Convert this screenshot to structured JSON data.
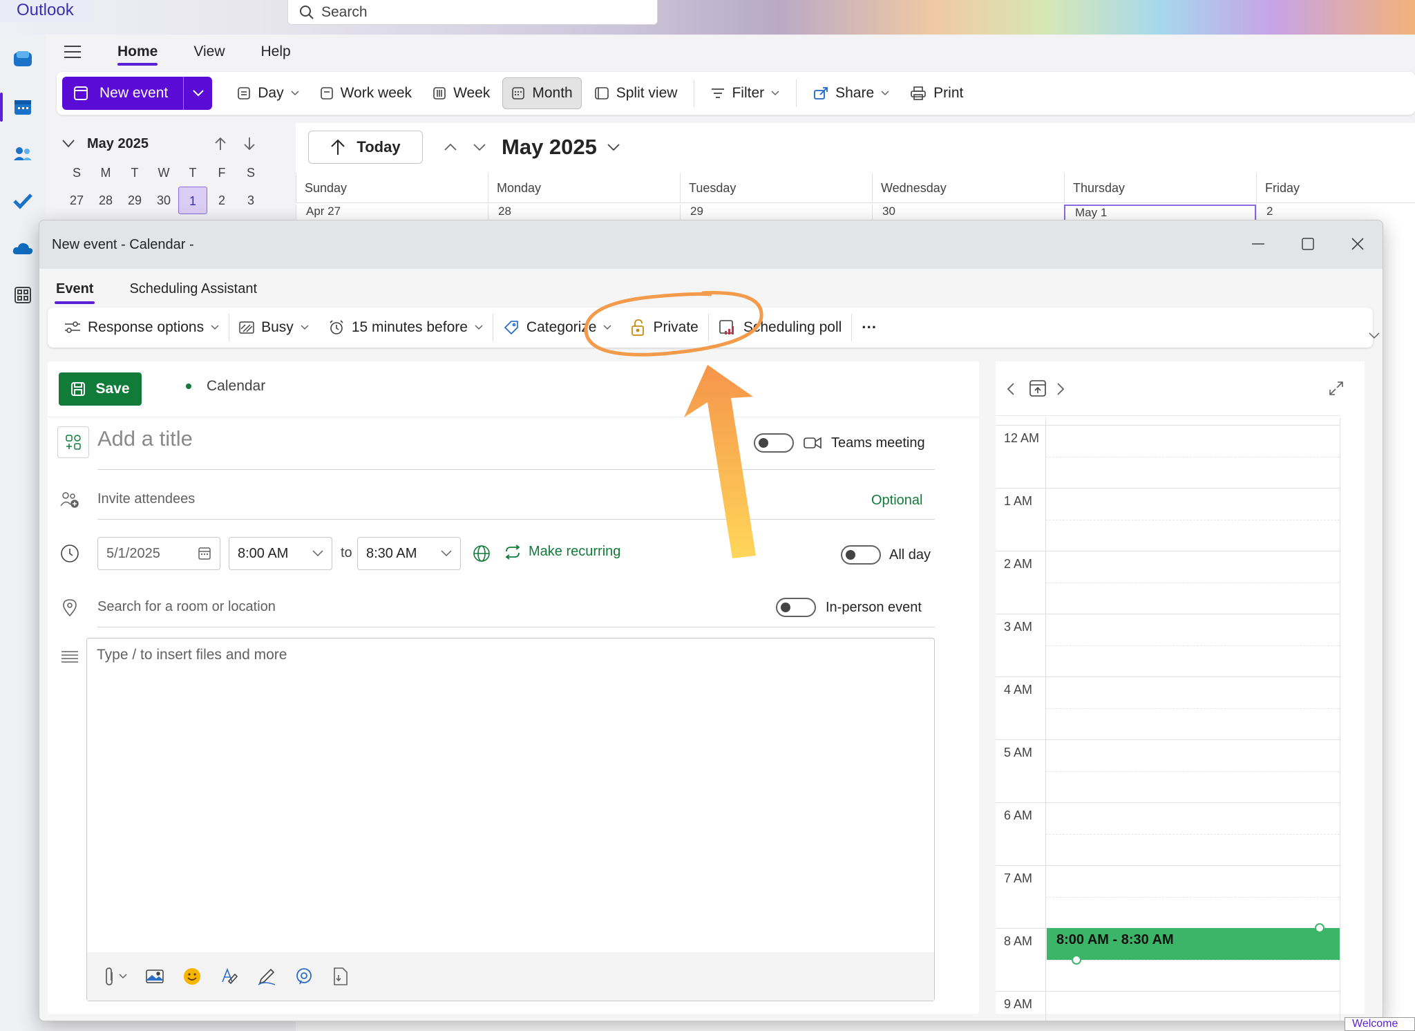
{
  "app": {
    "title": "Outlook"
  },
  "search": {
    "placeholder": "Search"
  },
  "ribbon": {
    "tabs": [
      "Home",
      "View",
      "Help"
    ],
    "new_event": "New event",
    "buttons": {
      "day": "Day",
      "work_week": "Work week",
      "week": "Week",
      "month": "Month",
      "split_view": "Split view",
      "filter": "Filter",
      "share": "Share",
      "print": "Print"
    }
  },
  "mini_calendar": {
    "title": "May 2025",
    "dows": [
      "S",
      "M",
      "T",
      "W",
      "T",
      "F",
      "S"
    ],
    "first_row": [
      "27",
      "28",
      "29",
      "30",
      "1",
      "2",
      "3"
    ],
    "today_index": 4
  },
  "month_view": {
    "today": "Today",
    "title": "May 2025",
    "day_headers": [
      "Sunday",
      "Monday",
      "Tuesday",
      "Wednesday",
      "Thursday",
      "Friday"
    ],
    "first_row_dates": [
      "Apr 27",
      "28",
      "29",
      "30",
      "May 1",
      "2"
    ]
  },
  "modal": {
    "title": "New event - Calendar -",
    "tabs": [
      "Event",
      "Scheduling Assistant"
    ],
    "toolbar": {
      "response_options": "Response options",
      "busy": "Busy",
      "reminder": "15 minutes before",
      "categorize": "Categorize",
      "private": "Private",
      "scheduling_poll": "Scheduling poll",
      "more": "···"
    },
    "save": "Save",
    "calendar_label": "Calendar",
    "title_placeholder": "Add a title",
    "teams_meeting": "Teams meeting",
    "invite_placeholder": "Invite attendees",
    "optional": "Optional",
    "date": "5/1/2025",
    "start_time": "8:00 AM",
    "to": "to",
    "end_time": "8:30 AM",
    "make_recurring": "Make recurring",
    "all_day": "All day",
    "location_placeholder": "Search for a room or location",
    "in_person": "In-person event",
    "body_placeholder": "Type / to insert files and more"
  },
  "day_view": {
    "hours": [
      "12 AM",
      "1 AM",
      "2 AM",
      "3 AM",
      "4 AM",
      "5 AM",
      "6 AM",
      "7 AM",
      "8 AM",
      "9 AM"
    ],
    "event_label": "8:00 AM - 8:30 AM",
    "event_start_hour": 8
  },
  "footer": {
    "welcome": "Welcome"
  },
  "colors": {
    "accent": "#5b0bd6",
    "save_green": "#117b3a",
    "event_green": "#3cb568",
    "annotation_orange": "#f39a4b"
  }
}
